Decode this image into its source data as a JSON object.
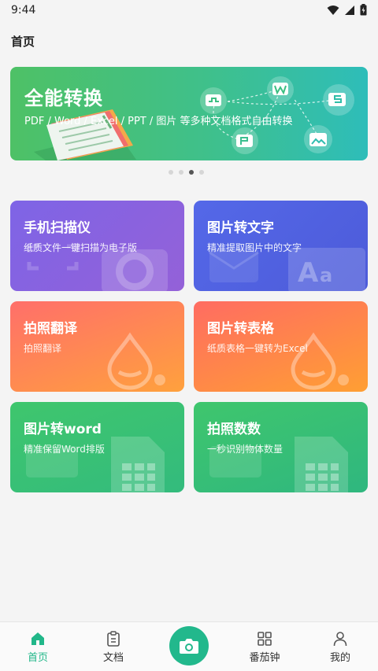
{
  "status_bar": {
    "time": "9:44"
  },
  "header": {
    "title": "首页"
  },
  "banner": {
    "title": "全能转换",
    "subtitle": "PDF / Word / Excel / PPT / 图片 等多种文档格式自由转换",
    "page_count": 4,
    "active_page": 3
  },
  "cards": [
    {
      "title": "手机扫描仪",
      "subtitle": "纸质文件一键扫描为电子版"
    },
    {
      "title": "图片转文字",
      "subtitle": "精准提取图片中的文字"
    },
    {
      "title": "拍照翻译",
      "subtitle": "拍照翻译"
    },
    {
      "title": "图片转表格",
      "subtitle": "纸质表格一键转为Excel"
    },
    {
      "title": "图片转word",
      "subtitle": "精准保留Word排版"
    },
    {
      "title": "拍照数数",
      "subtitle": "一秒识别物体数量"
    }
  ],
  "nav": {
    "items": [
      {
        "label": "首页",
        "icon": "home-icon",
        "active": true
      },
      {
        "label": "文档",
        "icon": "document-icon",
        "active": false
      },
      {
        "label": "",
        "icon": "camera-icon",
        "active": false
      },
      {
        "label": "番茄钟",
        "icon": "grid-icon",
        "active": false
      },
      {
        "label": "我的",
        "icon": "person-icon",
        "active": false
      }
    ]
  },
  "colors": {
    "accent": "#22b88c",
    "banner_start": "#4ec166",
    "banner_end": "#2ebdb9"
  }
}
